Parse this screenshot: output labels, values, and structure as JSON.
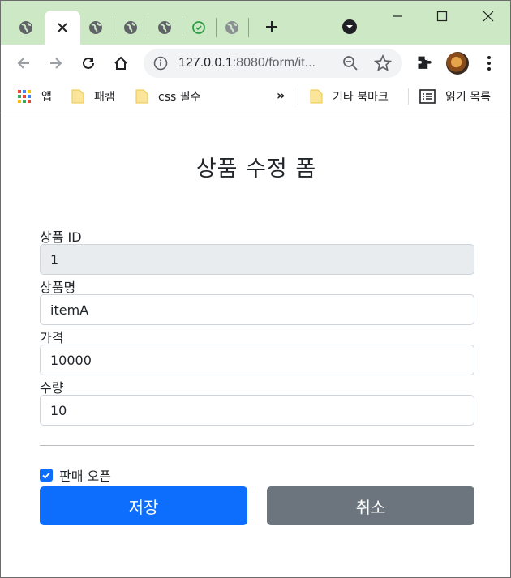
{
  "browser": {
    "url_host": "127.0.0.1",
    "url_rest": ":8080/form/it...",
    "colors": {
      "tabstrip": "#cde8c5",
      "omnibox": "#f1f3f4"
    },
    "tabs": [
      {
        "icon": "globe-icon",
        "active": false
      },
      {
        "icon": "close-icon",
        "active": true
      },
      {
        "icon": "globe-icon",
        "active": false
      },
      {
        "icon": "globe-icon",
        "active": false
      },
      {
        "icon": "globe-icon",
        "active": false
      },
      {
        "icon": "green-refresh-icon",
        "active": false
      },
      {
        "icon": "globe-icon",
        "active": false
      }
    ],
    "bookmarks": {
      "apps": "앱",
      "items": [
        "패캠",
        "css 필수"
      ],
      "more": "»",
      "other": "기타 북마크",
      "reading_list": "읽기 목록"
    }
  },
  "form": {
    "title": "상품 수정 폼",
    "fields": [
      {
        "label": "상품 ID",
        "value": "1",
        "readonly": true
      },
      {
        "label": "상품명",
        "value": "itemA",
        "readonly": false
      },
      {
        "label": "가격",
        "value": "10000",
        "readonly": false
      },
      {
        "label": "수량",
        "value": "10",
        "readonly": false
      }
    ],
    "open_label": "판매 오픈",
    "open_checked": true,
    "save_label": "저장",
    "cancel_label": "취소",
    "colors": {
      "primary": "#0d6efd",
      "secondary": "#6c757d",
      "readonly_bg": "#e9ecef"
    }
  }
}
